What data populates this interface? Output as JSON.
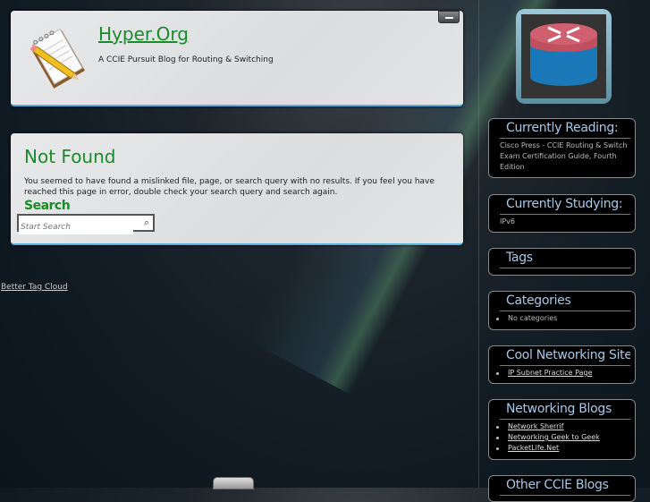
{
  "header": {
    "site_title": "Hyper.Org",
    "tagline": "A CCIE Pursuit Blog for Routing & Switching"
  },
  "content": {
    "title": "Not Found",
    "message": "You seemed to have found a mislinked file, page, or search query with no results. If you feel you have reached this page in error, double check your search query and search again.",
    "search_label": "Search",
    "search_placeholder": "Start Search"
  },
  "footer_link": "Better Tag Cloud",
  "sidebar": {
    "currently_reading": {
      "title": "Currently Reading:",
      "text": "Cisco Press - CCIE Routing & Switch Exam Certification Guide, Fourth Edition"
    },
    "currently_studying": {
      "title": "Currently Studying:",
      "text": "IPv6"
    },
    "tags": {
      "title": "Tags"
    },
    "categories": {
      "title": "Categories",
      "items": [
        "No categories"
      ]
    },
    "cool_sites": {
      "title": "Cool Networking Sites",
      "items": [
        "IP Subnet Practice Page"
      ]
    },
    "networking_blogs": {
      "title": "Networking Blogs",
      "items": [
        "Network Sherrif",
        "Networking Geek to Geek",
        "PacketLife.Net"
      ]
    },
    "other_ccie": {
      "title": "Other CCIE Blogs"
    }
  }
}
